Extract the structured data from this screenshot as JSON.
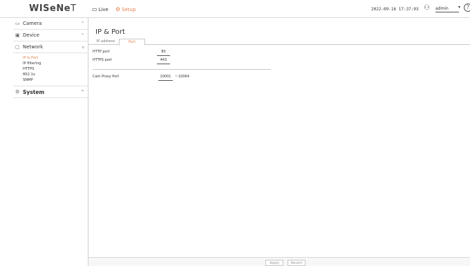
{
  "brand": {
    "logo_main": "WISeNe",
    "logo_tail": "T"
  },
  "topnav": {
    "live_icon": "monitor-icon",
    "live_label": "Live",
    "setup_icon": "gear-icon",
    "setup_label": "Setup"
  },
  "header": {
    "datetime": "2022-09-16 17:37:03",
    "user": "admin",
    "user_caret": "▾",
    "help": "?"
  },
  "sidebar": {
    "camera": {
      "label": "Camera",
      "chevron": "^"
    },
    "device": {
      "label": "Device",
      "chevron": "^"
    },
    "network": {
      "label": "Network",
      "chevron": "v",
      "items": [
        "IP & Port",
        "IP filtering",
        "HTTPS",
        "802.1x",
        "SNMP"
      ]
    },
    "system": {
      "label": "System",
      "chevron": "^"
    }
  },
  "page": {
    "title": "IP & Port",
    "tabs": [
      "IP address",
      "Port"
    ],
    "active_tab": "Port"
  },
  "ports": {
    "http_label": "HTTP port",
    "http_value": "80",
    "https_label": "HTTPS port",
    "https_value": "443",
    "cam_proxy_label": "Cam Proxy Port",
    "cam_proxy_start": "10001",
    "cam_proxy_sep": "~",
    "cam_proxy_end": "10064"
  },
  "footer": {
    "apply_label": "Apply",
    "revert_label": "Revert"
  },
  "colors": {
    "accent": "#e8804a",
    "border": "#c8c8c8",
    "text": "#333333"
  }
}
